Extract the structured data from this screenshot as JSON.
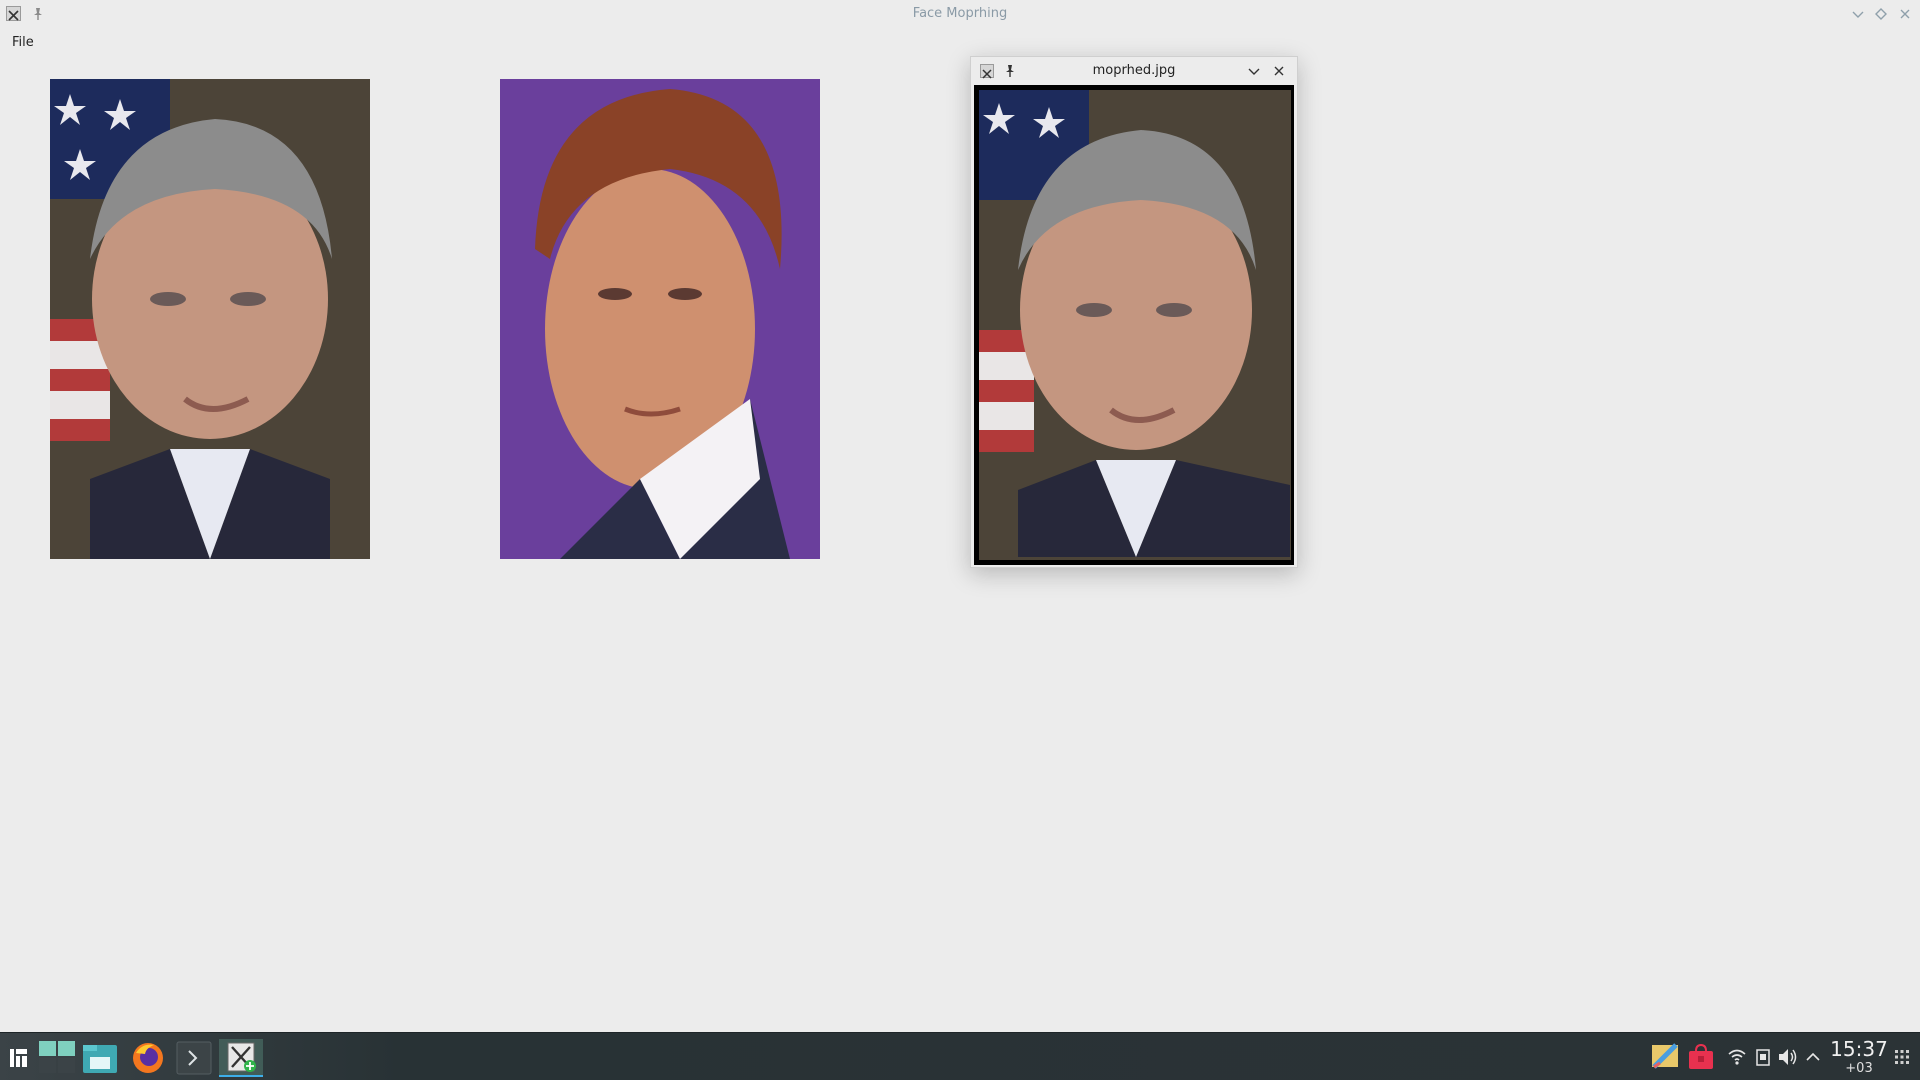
{
  "window": {
    "title": "Face Moprhing",
    "menu": {
      "file_label": "File"
    }
  },
  "images": {
    "left": {
      "icon": "photo-man-suit-flag-background"
    },
    "right": {
      "icon": "photo-man-suit-purple-background"
    }
  },
  "result_window": {
    "title": "moprhed.jpg",
    "image_icon": "photo-morphed-face"
  },
  "taskbar": {
    "launchers": [
      "start-menu-icon",
      "desktop-icon",
      "file-manager-icon",
      "firefox-icon",
      "terminal-icon",
      "face-morph-app-icon"
    ],
    "tray": [
      "notes-icon",
      "store-bag-icon",
      "network-icon",
      "device-icon",
      "volume-icon",
      "expand-arrow-icon",
      "app-grid-icon"
    ],
    "clock": {
      "time": "15:37",
      "timezone": "+03"
    }
  },
  "colors": {
    "background": "#ececec",
    "title_text": "#8a9aa6",
    "taskbar": "#2b3336",
    "accent": "#3daee9",
    "purple_backdrop": "#6a3f9c"
  }
}
